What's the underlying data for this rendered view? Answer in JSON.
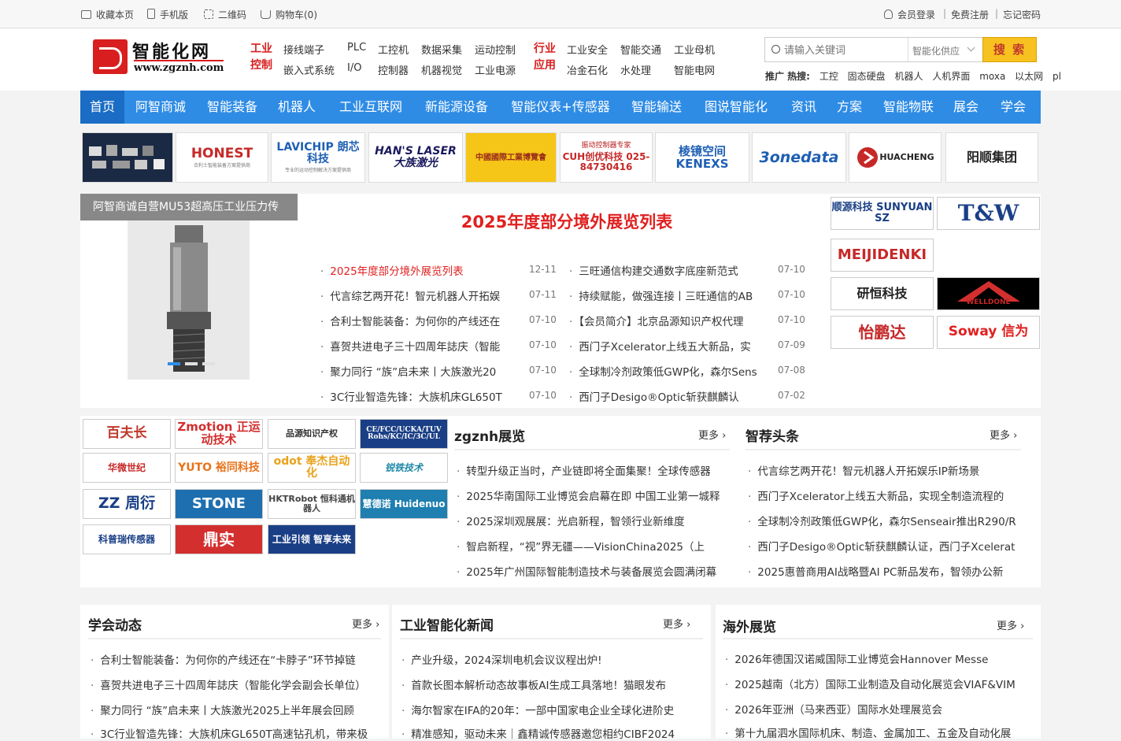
{
  "topbar": {
    "bookmark": "收藏本页",
    "mobile": "手机版",
    "qrcode": "二维码",
    "cart": "购物车(0)",
    "login": "会员登录",
    "register": "免费注册",
    "forgot": "忘记密码"
  },
  "logo": {
    "name": "智能化网",
    "url": "www.zgznh.com"
  },
  "header": {
    "cat1": "工业控制",
    "cat2": "行业应用",
    "links1": [
      "接线端子",
      "PLC",
      "工控机",
      "数据采集",
      "运动控制",
      "嵌入式系统",
      "I/O",
      "控制器",
      "机器视觉",
      "工业电源"
    ],
    "links2": [
      "工业安全",
      "智能交通",
      "工业母机",
      "冶金石化",
      "水处理",
      "智能电网"
    ]
  },
  "search": {
    "placeholder": "请输入关键词",
    "select": "智能化供应",
    "button": "搜 索"
  },
  "hot": {
    "label": "推广 热搜:",
    "words": [
      "工控",
      "固态硬盘",
      "机器人",
      "人机界面",
      "moxa",
      "以太网",
      "pl"
    ]
  },
  "nav": [
    "首页",
    "阿智商诚",
    "智能装备",
    "机器人",
    "工业互联网",
    "新能源设备",
    "智能仪表+传感器",
    "智能输送",
    "图说智能化",
    "资讯",
    "方案",
    "智能物联",
    "展会",
    "学会"
  ],
  "ads": [
    "",
    "HONEST",
    "LAVICHIP 朗芯科技",
    "HAN'S LASER 大族激光",
    "中國國際工業博覽會",
    "CUH创优科技 025-84730416",
    "棱镜空间 KENEXS",
    "3onedata",
    "HUACHENG",
    "阳顺集团"
  ],
  "ad_sub": {
    "honest": "合利士智能装备方案提供商",
    "lavichip": "专业的运动控制解决方案提供商",
    "cuh": "振动控制器专家"
  },
  "slider": {
    "caption": "阿智商诚自营MU53超高压工业压力传"
  },
  "headline": "2025年度部分境外展览列表",
  "news_left": [
    {
      "t": "2025年度部分境外展览列表",
      "d": "12-11"
    },
    {
      "t": "代言综艺两开花！智元机器人开拓娱",
      "d": "07-11"
    },
    {
      "t": "合利士智能装备：为何你的产线还在",
      "d": "07-10"
    },
    {
      "t": "喜贺共进电子三十四周年誌庆（智能",
      "d": "07-10"
    },
    {
      "t": "聚力同行 “族”启未来丨大族激光20",
      "d": "07-10"
    },
    {
      "t": "3C行业智造先锋：大族机床GL650T",
      "d": "07-10"
    }
  ],
  "news_right": [
    {
      "t": "三旺通信构建交通数字底座新范式",
      "d": "07-10"
    },
    {
      "t": "持续赋能，做强连接丨三旺通信的AB",
      "d": "07-10"
    },
    {
      "t": "【会员简介】北京品源知识产权代理",
      "d": "07-10"
    },
    {
      "t": "西门子Xcelerator上线五大新品，实",
      "d": "07-09"
    },
    {
      "t": "全球制冷剂政策低GWP化，森尔Sens",
      "d": "07-08"
    },
    {
      "t": "西门子Desigo®Optic斩获麒麟认",
      "d": "07-02"
    }
  ],
  "right_logos": [
    "顺源科技 SUNYUAN SZ",
    "T&W",
    "MEIJIDENKI",
    "研恒科技",
    "WELLDONE",
    "怡鹏达",
    "Soway 信为"
  ],
  "partners": [
    "百夫长",
    "Zmotion 正运动技术",
    "品源知识产权",
    "CE/FCC/UCKA/TUV Rohs/KC/IC/3C/UL",
    "华微世纪",
    "YUTO 裕同科技",
    "odot 奉杰自动化",
    "锐铁技术",
    "ZZ 周衍",
    "STONE",
    "HKTRobot 恒科通机器人",
    "慧德诺 Huidenuo",
    "科普瑞传感器",
    "鼎实",
    "工业引领 智享未来"
  ],
  "zgznh": {
    "title": "zgznh展览",
    "more": "更多",
    "items": [
      "转型升级正当时，产业链即将全面集聚！全球传感器",
      "2025华南国际工业博览会启幕在即 中国工业第一城释",
      "2025深圳观展展：光启新程，智领行业新维度",
      "智启新程，“视”界无疆——VisionChina2025（上",
      "2025年广州国际智能制造技术与装备展览会圆满闭幕"
    ]
  },
  "tuijian": {
    "title": "智荐头条",
    "more": "更多",
    "items": [
      "代言综艺两开花！智元机器人开拓娱乐IP新场景",
      "西门子Xcelerator上线五大新品，实现全制造流程的",
      "全球制冷剂政策低GWP化，森尔Senseair推出R290/R",
      "西门子Desigo®Optic斩获麒麟认证，西门子Xcelerat",
      "2025惠普商用AI战略暨AI PC新品发布，智领办公新"
    ]
  },
  "xuehui": {
    "title": "学会动态",
    "more": "更多",
    "items": [
      "合利士智能装备：为何你的产线还在“卡脖子”环节掉链",
      "喜贺共进电子三十四周年誌庆（智能化学会副会长单位）",
      "聚力同行 “族”启未来丨大族激光2025上半年展会回顾",
      "3C行业智造先锋：大族机床GL650T高速钻孔机，带来极"
    ]
  },
  "industry": {
    "title": "工业智能化新闻",
    "more": "更多",
    "items": [
      "产业升级，2024深圳电机会议议程出炉!",
      "首款长图本解析动态故事板AI生成工具落地！猫眼发布",
      "海尔智家在IFA的20年：一部中国家电企业全球化进阶史",
      "精准感知，驱动未来｜鑫精诚传感器邀您相约CIBF2024"
    ]
  },
  "overseas": {
    "title": "海外展览",
    "more": "更多",
    "items": [
      "2026年德国汉诺威国际工业博览会Hannover Messe",
      "2025越南（北方）国际工业制造及自动化展览会VIAF&VIM",
      "2026年亚洲（马来西亚）国际水处理展览会",
      "第十九届泗水国际机床、制造、金属加工、五金及自动化展"
    ]
  }
}
